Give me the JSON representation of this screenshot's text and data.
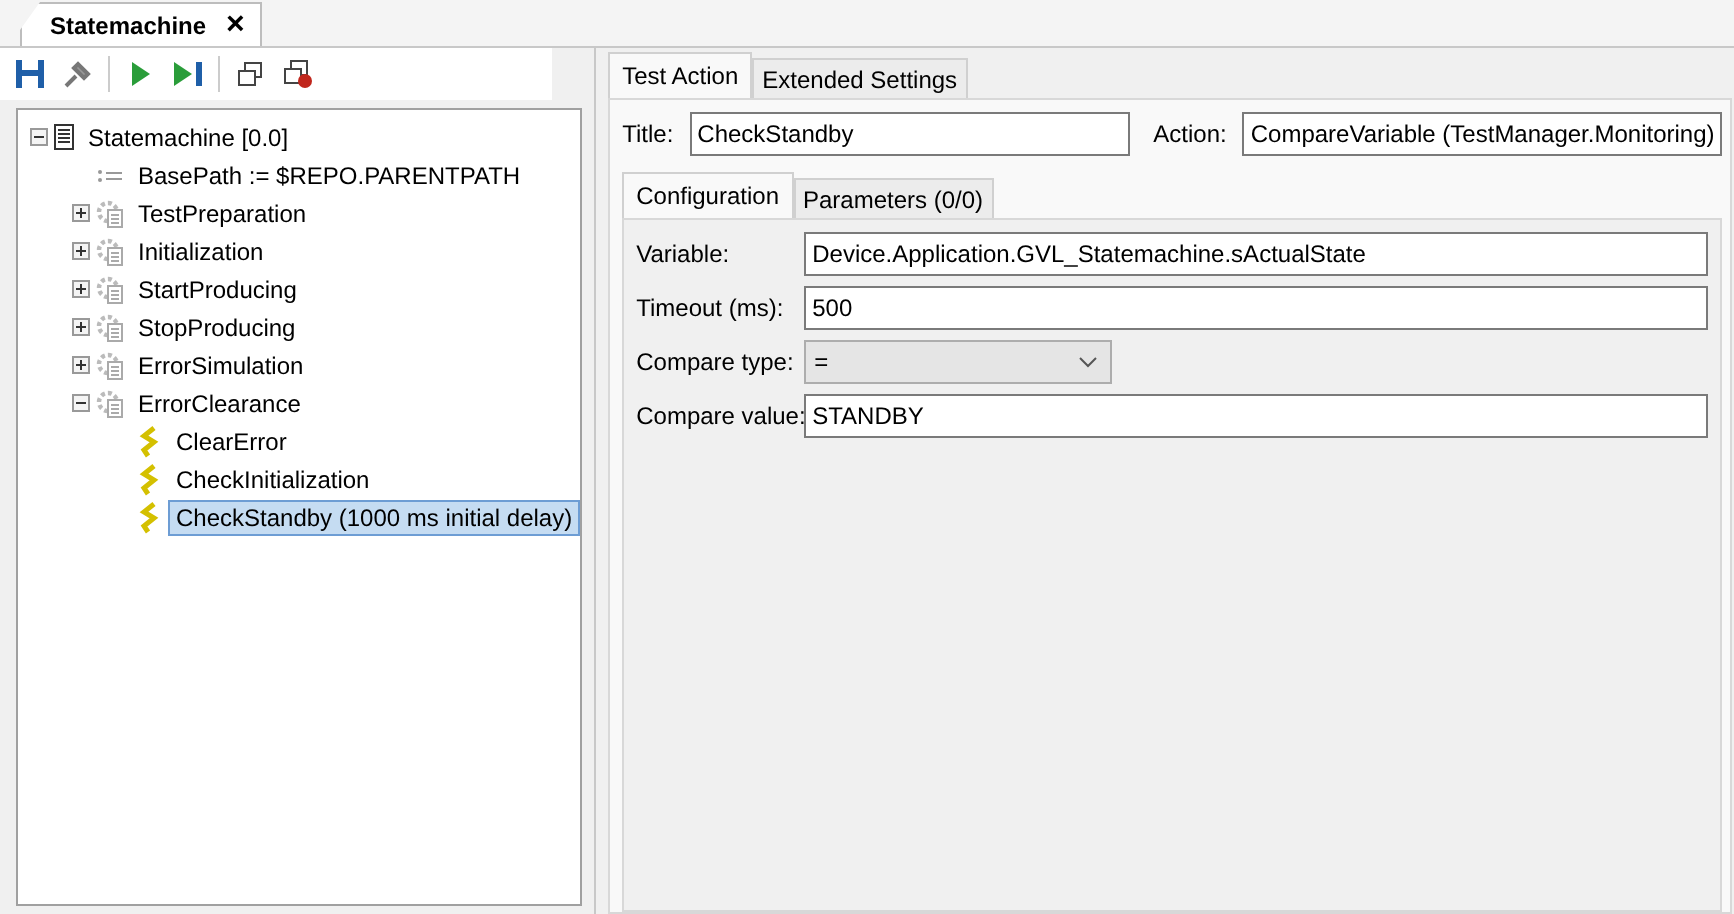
{
  "document_tab": {
    "title": "Statemachine",
    "close": "×"
  },
  "tree": [
    {
      "kind": "machine",
      "label": "Statemachine [0.0]",
      "expanded": true,
      "selected": false,
      "children": [
        {
          "kind": "assign",
          "label": "BasePath := $REPO.PARENTPATH",
          "selected": false
        },
        {
          "kind": "group",
          "label": "TestPreparation",
          "expanded": false,
          "selected": false
        },
        {
          "kind": "group",
          "label": "Initialization",
          "expanded": false,
          "selected": false
        },
        {
          "kind": "group",
          "label": "StartProducing",
          "expanded": false,
          "selected": false
        },
        {
          "kind": "group",
          "label": "StopProducing",
          "expanded": false,
          "selected": false
        },
        {
          "kind": "group",
          "label": "ErrorSimulation",
          "expanded": false,
          "selected": false
        },
        {
          "kind": "group",
          "label": "ErrorClearance",
          "expanded": true,
          "selected": false,
          "children": [
            {
              "kind": "action",
              "label": "ClearError",
              "selected": false
            },
            {
              "kind": "action",
              "label": "CheckInitialization",
              "selected": false
            },
            {
              "kind": "action",
              "label": "CheckStandby (1000 ms initial delay)",
              "selected": true
            }
          ]
        }
      ]
    }
  ],
  "tabs": [
    {
      "label": "Test Action",
      "selected": true
    },
    {
      "label": "Extended Settings",
      "selected": false
    }
  ],
  "title_field": {
    "label": "Title:",
    "value": "CheckStandby"
  },
  "action_field": {
    "label": "Action:",
    "value": "CompareVariable (TestManager.Monitoring)"
  },
  "sub_tabs": [
    {
      "label": "Configuration",
      "selected": true
    },
    {
      "label": "Parameters (0/0)",
      "selected": false
    }
  ],
  "config": [
    {
      "kind": "text",
      "label": "Variable:",
      "value": "Device.Application.GVL_Statemachine.sActualState"
    },
    {
      "kind": "text",
      "label": "Timeout (ms):",
      "value": "500"
    },
    {
      "kind": "select",
      "label": "Compare type:",
      "value": "="
    },
    {
      "kind": "text",
      "label": "Compare value:",
      "value": "STANDBY"
    }
  ]
}
